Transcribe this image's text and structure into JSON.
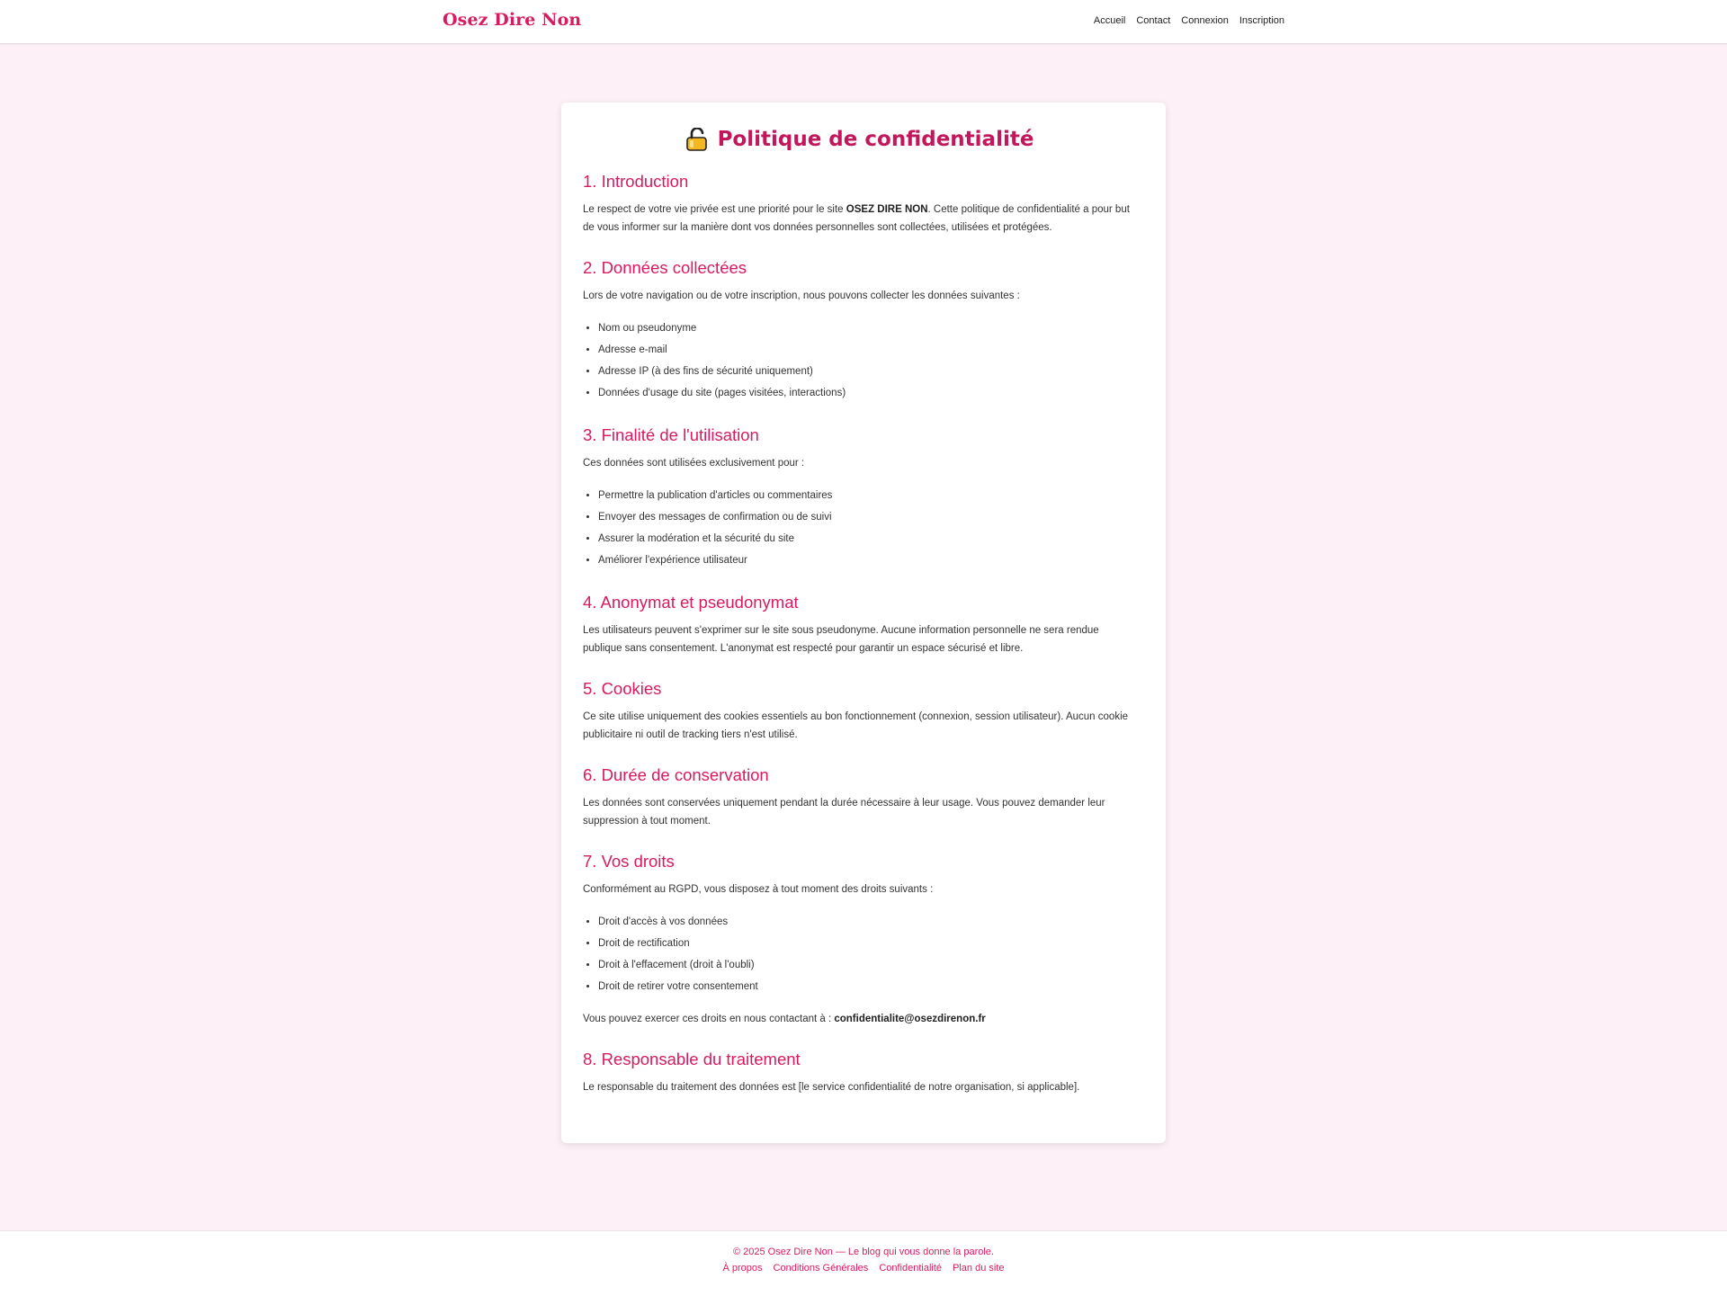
{
  "header": {
    "brand": "Osez Dire Non",
    "nav": [
      "Accueil",
      "Contact",
      "Connexion",
      "Inscription"
    ]
  },
  "page": {
    "title": "Politique de confidentialité",
    "title_icon": "lock-icon",
    "sections": [
      {
        "heading": "1. Introduction",
        "paragraph_parts": [
          "Le respect de votre vie privée est une priorité pour le site ",
          "OSEZ DIRE NON",
          ". Cette politique de confidentialité a pour but de vous informer sur la manière dont vos données personnelles sont collectées, utilisées et protégées."
        ]
      },
      {
        "heading": "2. Données collectées",
        "paragraph": "Lors de votre navigation ou de votre inscription, nous pouvons collecter les données suivantes :",
        "items": [
          "Nom ou pseudonyme",
          "Adresse e-mail",
          "Adresse IP (à des fins de sécurité uniquement)",
          "Données d'usage du site (pages visitées, interactions)"
        ]
      },
      {
        "heading": "3. Finalité de l'utilisation",
        "paragraph": "Ces données sont utilisées exclusivement pour :",
        "items": [
          "Permettre la publication d'articles ou commentaires",
          "Envoyer des messages de confirmation ou de suivi",
          "Assurer la modération et la sécurité du site",
          "Améliorer l'expérience utilisateur"
        ]
      },
      {
        "heading": "4. Anonymat et pseudonymat",
        "paragraph": "Les utilisateurs peuvent s'exprimer sur le site sous pseudonyme. Aucune information personnelle ne sera rendue publique sans consentement. L'anonymat est respecté pour garantir un espace sécurisé et libre."
      },
      {
        "heading": "5. Cookies",
        "paragraph": "Ce site utilise uniquement des cookies essentiels au bon fonctionnement (connexion, session utilisateur). Aucun cookie publicitaire ni outil de tracking tiers n'est utilisé."
      },
      {
        "heading": "6. Durée de conservation",
        "paragraph": "Les données sont conservées uniquement pendant la durée nécessaire à leur usage. Vous pouvez demander leur suppression à tout moment."
      },
      {
        "heading": "7. Vos droits",
        "paragraph": "Conformément au RGPD, vous disposez à tout moment des droits suivants :",
        "items": [
          "Droit d'accès à vos données",
          "Droit de rectification",
          "Droit à l'effacement (droit à l'oubli)",
          "Droit de retirer votre consentement"
        ],
        "contact_text": "Vous pouvez exercer ces droits en nous contactant à : ",
        "contact_email": "confidentialite@osezdirenon.fr"
      },
      {
        "heading": "8. Responsable du traitement",
        "paragraph": "Le responsable du traitement des données est [le service confidentialité de notre organisation, si applicable]."
      }
    ]
  },
  "footer": {
    "copyright": "© 2025 Osez Dire Non — Le blog qui vous donne la parole.",
    "links": [
      "À propos",
      "Conditions Générales",
      "Confidentialité",
      "Plan du site"
    ]
  },
  "colors": {
    "accent": "#d81b60",
    "background": "#fdf0f6",
    "card": "#ffffff",
    "text": "#333333"
  }
}
